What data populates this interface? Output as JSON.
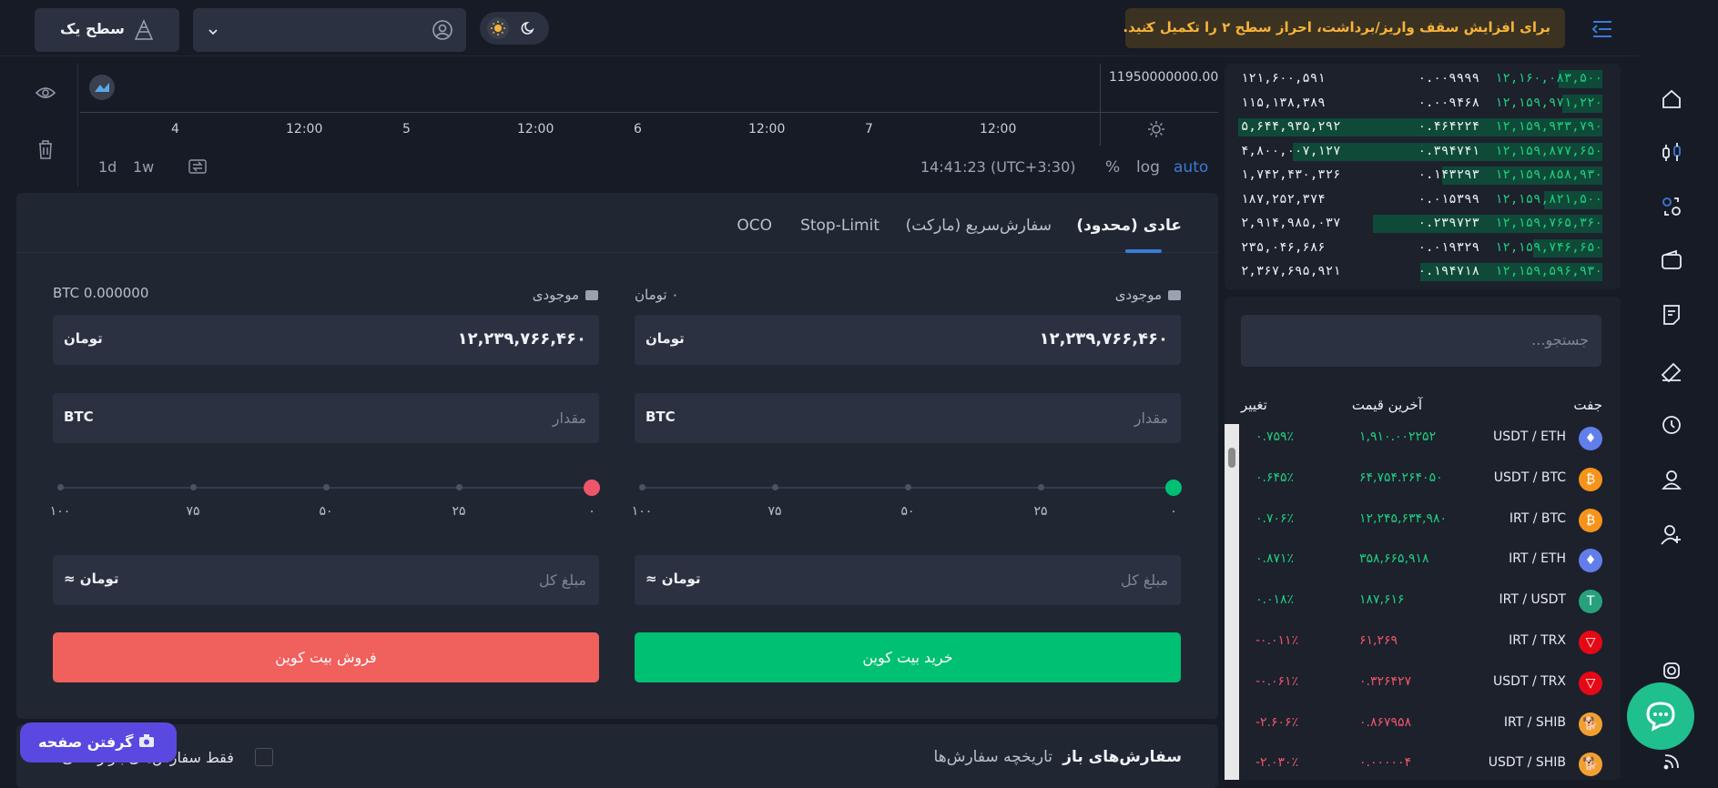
{
  "header": {
    "logo_icon": "logo-icon",
    "menu_icon": "menu-collapse-icon",
    "notice_text": "برای افزایش سقف واریز/برداشت، احراز سطح ۲ را تکمیل کنید.",
    "notice_arrow": "›",
    "level_label": "سطح یک",
    "profile_dropdown_value": ""
  },
  "chart": {
    "price_label": "11950000000.00",
    "x_ticks": [
      "4",
      "12:00",
      "5",
      "12:00",
      "6",
      "12:00",
      "7",
      "12:00"
    ],
    "intervals": [
      "1d",
      "1w"
    ],
    "time_readout": "14:41:23 (UTC+3:30)",
    "scale_opts": [
      "%",
      "log",
      "auto"
    ]
  },
  "order_form": {
    "tabs": [
      "عادی (محدود)",
      "سفارش‌سریع (مارکت)",
      "Stop-Limit",
      "OCO"
    ],
    "buy": {
      "balance_label": "موجودی",
      "balance_value": "۰ تومان",
      "price_value": "۱۲,۲۳۹,۷۶۶,۴۶۰",
      "price_unit": "تومان",
      "amount_placeholder": "مقدار",
      "amount_unit": "BTC",
      "slider_labels": [
        "۰",
        "۲۵",
        "۵۰",
        "۷۵",
        "۱۰۰"
      ],
      "total_placeholder": "مبلغ کل",
      "total_unit": "≈ تومان",
      "submit_label": "خرید بیت کوین"
    },
    "sell": {
      "balance_label": "موجودی",
      "balance_value": "BTC 0.000000",
      "price_value": "۱۲,۲۳۹,۷۶۶,۴۶۰",
      "price_unit": "تومان",
      "amount_placeholder": "مقدار",
      "amount_unit": "BTC",
      "slider_labels": [
        "۰",
        "۲۵",
        "۵۰",
        "۷۵",
        "۱۰۰"
      ],
      "total_placeholder": "مبلغ کل",
      "total_unit": "≈ تومان",
      "submit_label": "فروش بیت کوین"
    }
  },
  "orders": {
    "tab_open": "سفارش‌های باز",
    "tab_history": "تاریخچه سفارش‌ها",
    "filter_label": "فقط سفارش‌های بازار فعلی",
    "screenshot_button": "گرفتن صفحه"
  },
  "orderbook": {
    "rows": [
      {
        "price": "۱۲,۱۶۰,۰۸۳,۵۰۰",
        "amount": "۰.۰۰۹۹۹۹",
        "total": "۱۲۱,۶۰۰,۵۹۱",
        "depth": 0.12
      },
      {
        "price": "۱۲,۱۵۹,۹۷۱,۲۲۰",
        "amount": "۰.۰۰۹۴۶۸",
        "total": "۱۱۵,۱۳۸,۳۸۹",
        "depth": 0.11
      },
      {
        "price": "۱۲,۱۵۹,۹۳۳,۷۹۰",
        "amount": "۰.۴۶۴۲۲۴",
        "total": "۵,۶۴۴,۹۳۵,۲۹۲",
        "depth": 1.0
      },
      {
        "price": "۱۲,۱۵۹,۸۷۷,۶۵۰",
        "amount": "۰.۳۹۴۷۴۱",
        "total": "۴,۸۰۰,۰۰۷,۱۲۷",
        "depth": 0.85
      },
      {
        "price": "۱۲,۱۵۹,۸۵۸,۹۳۰",
        "amount": "۰.۱۴۳۲۹۳",
        "total": "۱,۷۴۲,۴۳۰,۳۲۶",
        "depth": 0.44
      },
      {
        "price": "۱۲,۱۵۹,۸۲۱,۵۰۰",
        "amount": "۰.۰۱۵۳۹۹",
        "total": "۱۸۷,۲۵۲,۳۷۴",
        "depth": 0.16
      },
      {
        "price": "۱۲,۱۵۹,۷۶۵,۳۶۰",
        "amount": "۰.۲۳۹۷۲۳",
        "total": "۲,۹۱۴,۹۸۵,۰۳۷",
        "depth": 0.63
      },
      {
        "price": "۱۲,۱۵۹,۷۴۶,۶۵۰",
        "amount": "۰.۰۱۹۳۲۹",
        "total": "۲۳۵,۰۴۶,۶۸۶",
        "depth": 0.19
      },
      {
        "price": "۱۲,۱۵۹,۵۹۶,۹۳۰",
        "amount": "۰.۱۹۴۷۱۸",
        "total": "۲,۳۶۷,۶۹۵,۹۲۱",
        "depth": 0.5
      }
    ]
  },
  "markets": {
    "search_placeholder": "جستجو...",
    "col_pair": "جفت",
    "col_price": "آخرین قیمت",
    "col_change": "تغییر",
    "rows": [
      {
        "pair": "USDT / ETH",
        "price": "۱,۹۱۰.۰۰۲۲۵۲",
        "change": "۰.۷۵۹٪",
        "up": true,
        "coin_color": "#627eea",
        "coin_glyph": "♦"
      },
      {
        "pair": "USDT / BTC",
        "price": "۶۴,۷۵۴.۲۶۴۰۵۰",
        "change": "۰.۶۴۵٪",
        "up": true,
        "coin_color": "#f7931a",
        "coin_glyph": "₿"
      },
      {
        "pair": "IRT / BTC",
        "price": "۱۲,۲۴۵,۶۳۴,۹۸۰",
        "change": "۰.۷۰۶٪",
        "up": true,
        "coin_color": "#f7931a",
        "coin_glyph": "₿"
      },
      {
        "pair": "IRT / ETH",
        "price": "۳۵۸,۶۶۵,۹۱۸",
        "change": "۰.۸۷۱٪",
        "up": true,
        "coin_color": "#627eea",
        "coin_glyph": "♦"
      },
      {
        "pair": "IRT / USDT",
        "price": "۱۸۷,۶۱۶",
        "change": "۰.۰۱۸٪",
        "up": true,
        "coin_color": "#26a17b",
        "coin_glyph": "T"
      },
      {
        "pair": "IRT / TRX",
        "price": "۶۱,۲۶۹",
        "change": "-۰.۰۱۱٪",
        "up": false,
        "coin_color": "#e50915",
        "coin_glyph": "▽"
      },
      {
        "pair": "USDT / TRX",
        "price": "۰.۳۲۶۴۲۷",
        "change": "-۰.۰۶۱٪",
        "up": false,
        "coin_color": "#e50915",
        "coin_glyph": "▽"
      },
      {
        "pair": "IRT / SHIB",
        "price": "۰.۸۶۷۹۵۸",
        "change": "-۲.۶۰۶٪",
        "up": false,
        "coin_color": "#f0a030",
        "coin_glyph": "🐕"
      },
      {
        "pair": "USDT / SHIB",
        "price": "۰.۰۰۰۰۰۴",
        "change": "-۲.۰۳۰٪",
        "up": false,
        "coin_color": "#f0a030",
        "coin_glyph": "🐕"
      }
    ]
  },
  "sidebar": {
    "icons": [
      "home-icon",
      "trade-icon",
      "exchange-icon",
      "wallet-icon",
      "orders-icon",
      "coupon-icon",
      "history-icon",
      "support-user-icon",
      "invite-user-icon",
      "instagram-icon",
      "rss-icon"
    ]
  },
  "colors": {
    "accent": "#3a7bd5",
    "buy": "#00c073",
    "sell": "#f0605d",
    "notice_bg": "#3b3222",
    "notice_text": "#f6b33a"
  }
}
